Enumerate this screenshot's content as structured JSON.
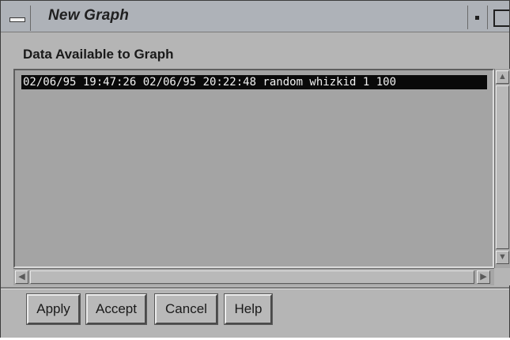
{
  "window": {
    "title": "New Graph"
  },
  "icons": {
    "window_menu": "window-menu-icon",
    "minimize": "minimize-icon",
    "maximize": "maximize-icon",
    "scroll_up": "arrow-up-icon",
    "scroll_down": "arrow-down-icon",
    "scroll_left": "arrow-left-icon",
    "scroll_right": "arrow-right-icon"
  },
  "main": {
    "label": "Data Available to Graph",
    "list_items": [
      {
        "text": "02/06/95 19:47:26 02/06/95 20:22:48 random whizkid 1 100",
        "selected": true
      }
    ]
  },
  "buttons": {
    "apply": "Apply",
    "accept": "Accept",
    "cancel": "Cancel",
    "help": "Help"
  },
  "colors": {
    "window_bg": "#b5b5b5",
    "list_bg": "#a4a4a4",
    "selection_bg": "#0a0a0a",
    "selection_fg": "#f0f0f0"
  }
}
